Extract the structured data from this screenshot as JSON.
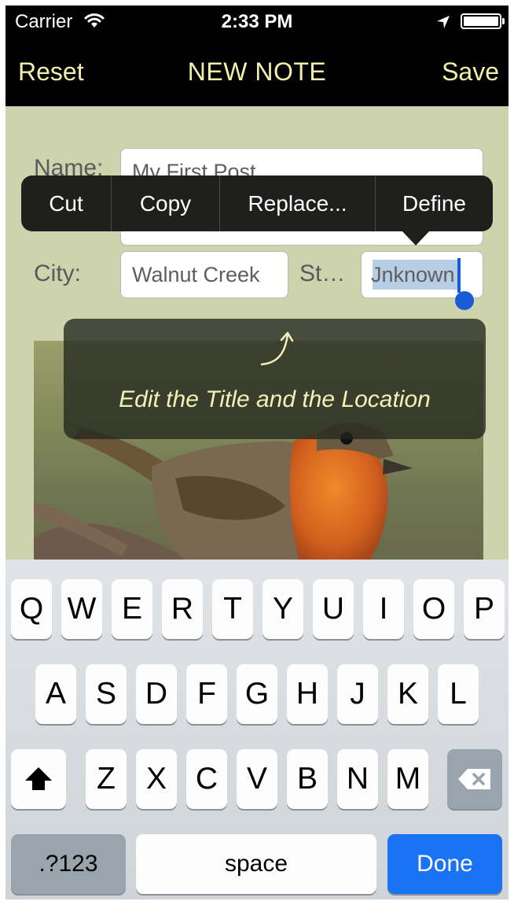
{
  "status": {
    "carrier": "Carrier",
    "time": "2:33 PM",
    "battery_level": 1.0
  },
  "nav": {
    "reset": "Reset",
    "title": "NEW NOTE",
    "save": "Save"
  },
  "form": {
    "name_label": "Name:",
    "name_value": "My First Post",
    "city_label": "City:",
    "city_value": "Walnut Creek",
    "state_label": "St…",
    "state_value": "Unknown",
    "state_visible": "Jnknown"
  },
  "edit_menu": {
    "cut": "Cut",
    "copy": "Copy",
    "replace": "Replace...",
    "define": "Define"
  },
  "tooltip": {
    "text": "Edit the Title and the Location"
  },
  "keyboard": {
    "row1": [
      "Q",
      "W",
      "E",
      "R",
      "T",
      "Y",
      "U",
      "I",
      "O",
      "P"
    ],
    "row2": [
      "A",
      "S",
      "D",
      "F",
      "G",
      "H",
      "J",
      "K",
      "L"
    ],
    "row3": [
      "Z",
      "X",
      "C",
      "V",
      "B",
      "N",
      "M"
    ],
    "numbers": ".?123",
    "space": "space",
    "done": "Done"
  },
  "colors": {
    "nav_text": "#f2f0a6",
    "background": "#cdd3ac",
    "accent": "#1a72f5",
    "caret": "#1a5bd6"
  }
}
